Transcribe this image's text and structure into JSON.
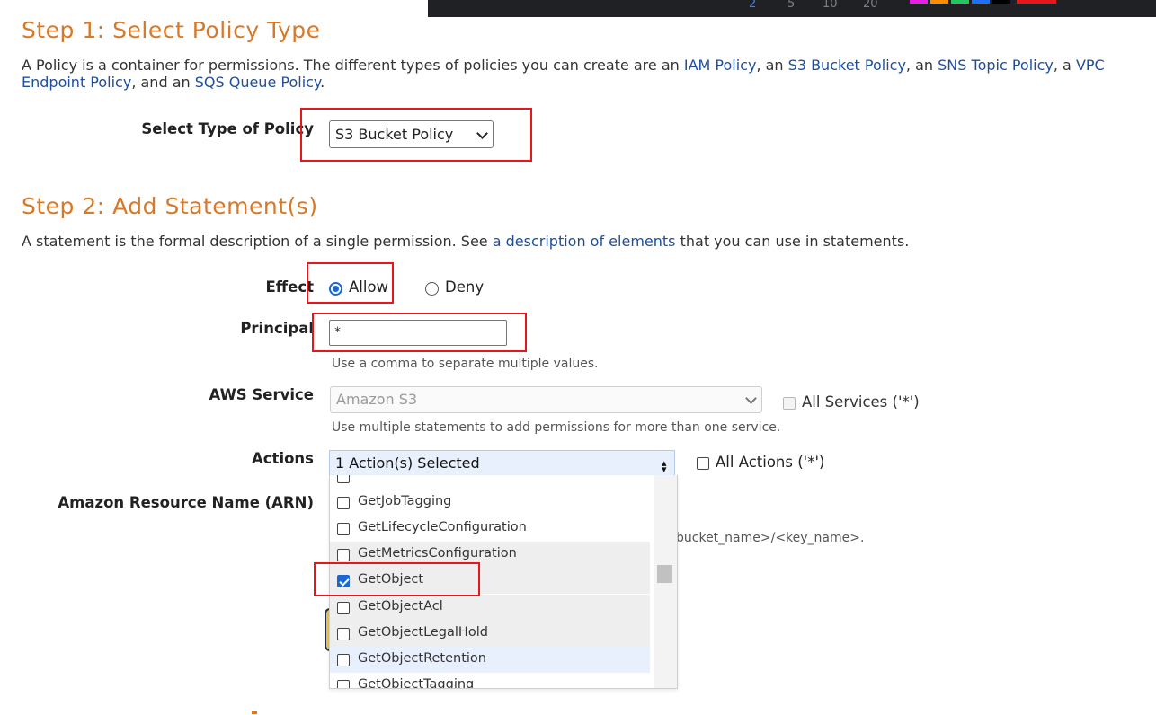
{
  "top_strip": {
    "numbers": [
      "2",
      "5",
      "10",
      "20"
    ],
    "swatch_colors": [
      "#e91ee6",
      "#ff8c00",
      "#22c55e",
      "#1e6ff5",
      "#000000",
      "#e8161b"
    ]
  },
  "step1": {
    "title": "Step 1: Select Policy Type",
    "desc_1": "A Policy is a container for permissions. The different types of policies you can create are an",
    "link_iam": "IAM Policy",
    "sep1": ", an",
    "link_s3": "S3 Bucket Policy",
    "sep2": ", an",
    "link_sns": "SNS Topic Policy",
    "sep3": ", a",
    "link_vpc": "VPC Endpoint Policy",
    "sep4": ", and an",
    "link_sqs": "SQS Queue Policy",
    "end": ".",
    "select_label": "Select Type of Policy",
    "select_value": "S3 Bucket Policy"
  },
  "step2": {
    "title": "Step 2: Add Statement(s)",
    "desc_1": "A statement is the formal description of a single permission. See",
    "link_desc": "a description of elements",
    "desc_2": "that you can use in statements.",
    "effect_label": "Effect",
    "effect_allow": "Allow",
    "effect_deny": "Deny",
    "principal_label": "Principal",
    "principal_value": "*",
    "principal_hint": "Use a comma to separate multiple values.",
    "service_label": "AWS Service",
    "service_value": "Amazon S3",
    "all_services": "All Services ('*')",
    "service_hint": "Use multiple statements to add permissions for more than one service.",
    "actions_label": "Actions",
    "actions_value": "1 Action(s) Selected",
    "all_actions": "All Actions ('*')",
    "arn_label": "Amazon Resource Name (ARN)",
    "arn_hint_partial": "bucket_name>/<key_name>.",
    "action_options": [
      {
        "label": "GetJobTagging",
        "checked": false
      },
      {
        "label": "GetLifecycleConfiguration",
        "checked": false
      },
      {
        "label": "GetMetricsConfiguration",
        "checked": false
      },
      {
        "label": "GetObject",
        "checked": true
      },
      {
        "label": "GetObjectAcl",
        "checked": false
      },
      {
        "label": "GetObjectLegalHold",
        "checked": false
      },
      {
        "label": "GetObjectRetention",
        "checked": false
      },
      {
        "label": "GetObjectTagging",
        "checked": false
      }
    ]
  }
}
